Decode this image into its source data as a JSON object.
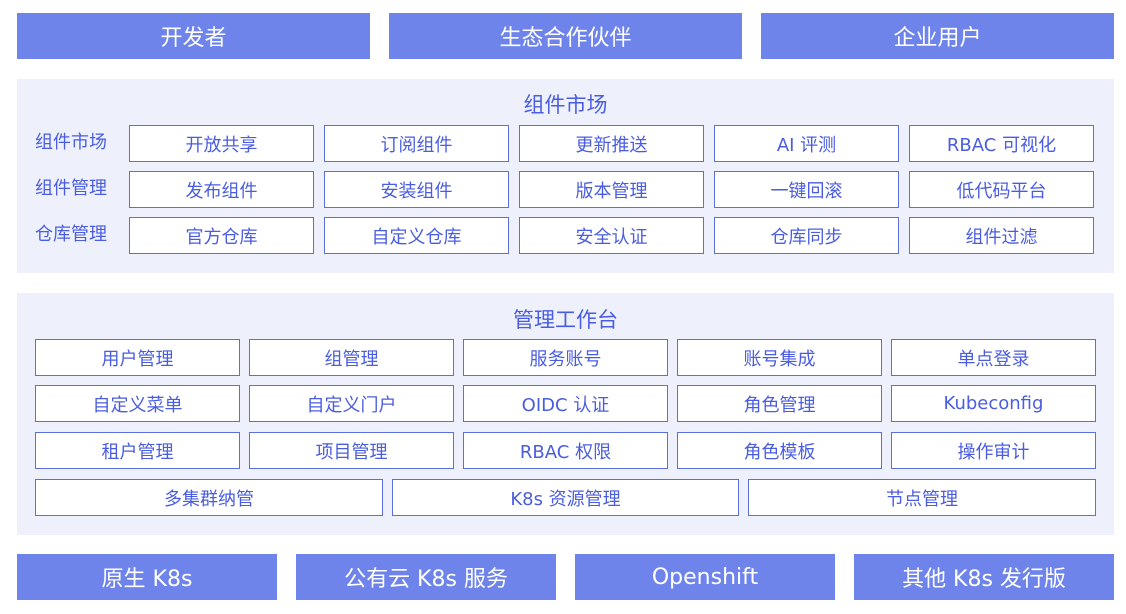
{
  "top_bar": [
    "开发者",
    "生态合作伙伴",
    "企业用户"
  ],
  "component_market": {
    "title": "组件市场",
    "rows": [
      {
        "label": "组件市场",
        "items": [
          "开放共享",
          "订阅组件",
          "更新推送",
          "AI 评测",
          "RBAC 可视化"
        ]
      },
      {
        "label": "组件管理",
        "items": [
          "发布组件",
          "安装组件",
          "版本管理",
          "一键回滚",
          "低代码平台"
        ]
      },
      {
        "label": "仓库管理",
        "items": [
          "官方仓库",
          "自定义仓库",
          "安全认证",
          "仓库同步",
          "组件过滤"
        ]
      }
    ]
  },
  "workbench": {
    "title": "管理工作台",
    "rows": [
      [
        "用户管理",
        "组管理",
        "服务账号",
        "账号集成",
        "单点登录"
      ],
      [
        "自定义菜单",
        "自定义门户",
        "OIDC 认证",
        "角色管理",
        "Kubeconfig"
      ],
      [
        "租户管理",
        "项目管理",
        "RBAC 权限",
        "角色模板",
        "操作审计"
      ],
      [
        "多集群纳管",
        "K8s 资源管理",
        "节点管理"
      ]
    ]
  },
  "bottom_bar": [
    "原生 K8s",
    "公有云 K8s 服务",
    "Openshift",
    "其他 K8s 发行版"
  ],
  "colors": {
    "bar_bg": "#6e84ea",
    "panel_bg": "#eef1fb",
    "accent_text": "#4a5de0",
    "cell_border": "#5b6fe0"
  }
}
